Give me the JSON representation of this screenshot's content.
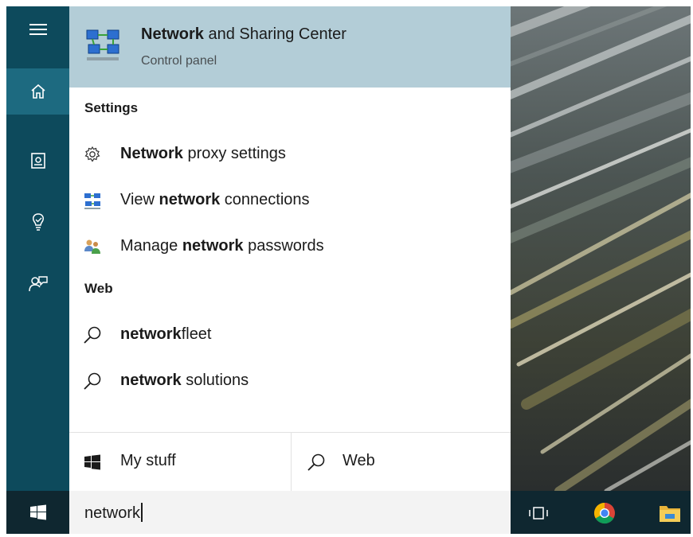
{
  "rail": {
    "items": [
      {
        "icon": "hamburger-menu-icon"
      },
      {
        "icon": "home-icon",
        "active": true
      },
      {
        "icon": "notebook-icon"
      },
      {
        "icon": "lightbulb-icon"
      },
      {
        "icon": "feedback-icon"
      }
    ]
  },
  "best_match": {
    "title_bold": "Network",
    "title_rest": " and Sharing Center",
    "subtitle": "Control panel",
    "icon": "network-sharing-center-icon"
  },
  "settings": {
    "header": "Settings",
    "items": [
      {
        "pre": "",
        "bold": "Network",
        "post": " proxy settings",
        "icon": "gear-icon"
      },
      {
        "pre": "View ",
        "bold": "network",
        "post": " connections",
        "icon": "network-connections-icon"
      },
      {
        "pre": "Manage ",
        "bold": "network",
        "post": " passwords",
        "icon": "credential-manager-icon"
      }
    ]
  },
  "web": {
    "header": "Web",
    "items": [
      {
        "pre": "",
        "bold": "network",
        "post": "fleet",
        "icon": "search-icon"
      },
      {
        "pre": "",
        "bold": "network",
        "post": " solutions",
        "icon": "search-icon"
      }
    ]
  },
  "bottom_tabs": {
    "my_stuff": "My stuff",
    "web": "Web"
  },
  "search": {
    "value": "network"
  },
  "taskbar": {
    "icons": [
      "task-view-icon",
      "chrome-icon",
      "file-explorer-icon"
    ]
  },
  "colors": {
    "rail": "#0d4a5c",
    "rail_active": "#1d6a80",
    "best_match_bg": "#b3cdd7",
    "taskbar": "#0f2730",
    "searchbox": "#f3f3f3"
  }
}
